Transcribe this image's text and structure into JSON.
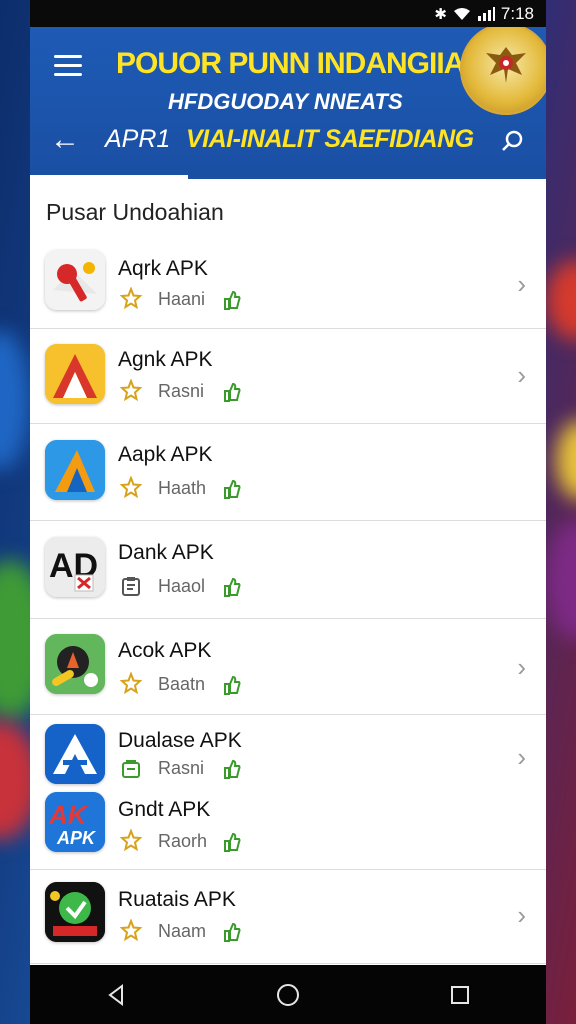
{
  "status_bar": {
    "time": "7:18"
  },
  "header": {
    "title": "POUOR PUNN INDANGIIA",
    "subtitle": "HFDGUODAY NNEATS",
    "tab_label": "APR1",
    "nav_title": "VIAI-INALIT SAEFIDIANG",
    "title_color": "#ffe423",
    "background_color": "#1e5bb5"
  },
  "section": {
    "title": "Pusar Undoahian"
  },
  "apps": [
    {
      "name": "Aqrk APK",
      "meta": "Haani",
      "meta_icon": "star-icon"
    },
    {
      "name": "Agnk APK",
      "meta": "Rasni",
      "meta_icon": "star-icon"
    },
    {
      "name": "Aapk APK",
      "meta": "Haath",
      "meta_icon": "star-icon"
    },
    {
      "name": "Dank APK",
      "meta": "Haaol",
      "meta_icon": "clipboard-icon"
    },
    {
      "name": "Acok APK",
      "meta": "Baatn",
      "meta_icon": "star-icon"
    },
    {
      "name": "Dualase APK",
      "meta": "Rasni",
      "meta_icon": "bag-icon"
    },
    {
      "name": "Gndt APK",
      "meta": "Raorh",
      "meta_icon": "star-icon"
    },
    {
      "name": "Ruatais APK",
      "meta": "Naam",
      "meta_icon": "star-icon"
    }
  ],
  "icons": {
    "menu": "hamburger-icon",
    "back": "arrow-left-icon",
    "search": "search-icon",
    "chevron": "chevron-right-icon",
    "like": "thumbs-up-icon",
    "nav_back": "triangle-back-icon",
    "nav_home": "circle-home-icon",
    "nav_recent": "square-recents-icon"
  },
  "colors": {
    "like_green": "#3a9b2c",
    "star_gold": "#d8a21a"
  }
}
